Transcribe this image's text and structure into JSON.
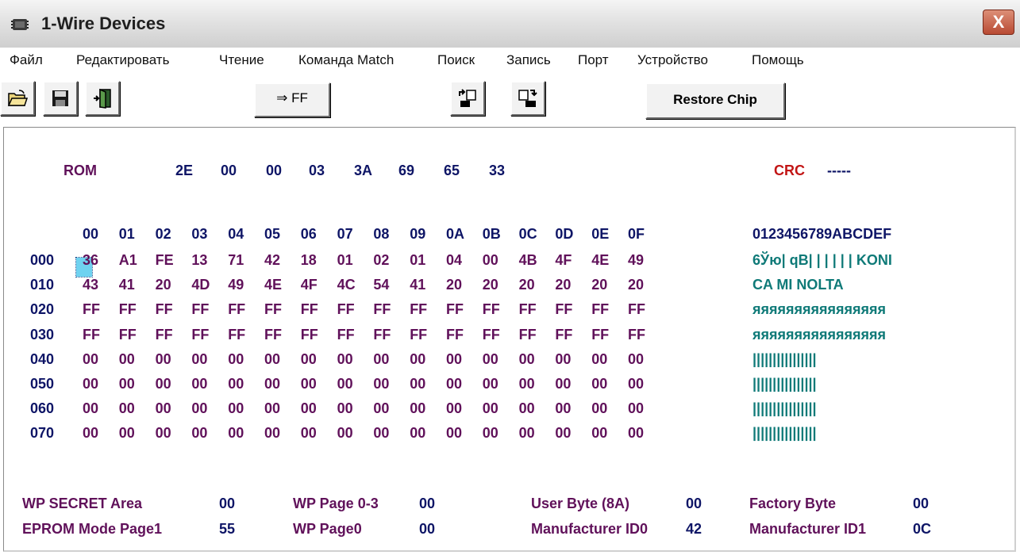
{
  "window": {
    "title": "1-Wire Devices",
    "close_glyph": "X",
    "icon": "chip-icon"
  },
  "menu": [
    "Файл",
    "Редактировать",
    "Чтение",
    "Команда Match",
    "Поиск",
    "Запись",
    "Порт",
    "Устройство",
    "Помощь"
  ],
  "toolbar": {
    "open_icon": "open-folder-icon",
    "save_icon": "save-disk-icon",
    "exit_icon": "exit-door-icon",
    "fill_label": "⇒ FF",
    "read_icon": "read-chip-icon",
    "write_icon": "write-chip-icon",
    "restore_label": "Restore Chip"
  },
  "rom": {
    "label": "ROM",
    "bytes": [
      "2E",
      "00",
      "00",
      "03",
      "3A",
      "69",
      "65",
      "33"
    ],
    "crc_label": "CRC",
    "crc_value": "-----"
  },
  "hex": {
    "col_headers": [
      "00",
      "01",
      "02",
      "03",
      "04",
      "05",
      "06",
      "07",
      "08",
      "09",
      "0A",
      "0B",
      "0C",
      "0D",
      "0E",
      "0F"
    ],
    "ascii_header": "0123456789ABCDEF",
    "rows": [
      {
        "addr": "000",
        "bytes": [
          "36",
          "A1",
          "FE",
          "13",
          "71",
          "42",
          "18",
          "01",
          "02",
          "01",
          "04",
          "00",
          "4B",
          "4F",
          "4E",
          "49"
        ],
        "ascii": "6Ўю| qB| | | | | | KONI"
      },
      {
        "addr": "010",
        "bytes": [
          "43",
          "41",
          "20",
          "4D",
          "49",
          "4E",
          "4F",
          "4C",
          "54",
          "41",
          "20",
          "20",
          "20",
          "20",
          "20",
          "20"
        ],
        "ascii": "CA MI NOLTA"
      },
      {
        "addr": "020",
        "bytes": [
          "FF",
          "FF",
          "FF",
          "FF",
          "FF",
          "FF",
          "FF",
          "FF",
          "FF",
          "FF",
          "FF",
          "FF",
          "FF",
          "FF",
          "FF",
          "FF"
        ],
        "ascii": "яяяяяяяяяяяяяяяя"
      },
      {
        "addr": "030",
        "bytes": [
          "FF",
          "FF",
          "FF",
          "FF",
          "FF",
          "FF",
          "FF",
          "FF",
          "FF",
          "FF",
          "FF",
          "FF",
          "FF",
          "FF",
          "FF",
          "FF"
        ],
        "ascii": "яяяяяяяяяяяяяяяя"
      },
      {
        "addr": "040",
        "bytes": [
          "00",
          "00",
          "00",
          "00",
          "00",
          "00",
          "00",
          "00",
          "00",
          "00",
          "00",
          "00",
          "00",
          "00",
          "00",
          "00"
        ],
        "ascii": "||||||||||||||||"
      },
      {
        "addr": "050",
        "bytes": [
          "00",
          "00",
          "00",
          "00",
          "00",
          "00",
          "00",
          "00",
          "00",
          "00",
          "00",
          "00",
          "00",
          "00",
          "00",
          "00"
        ],
        "ascii": "||||||||||||||||"
      },
      {
        "addr": "060",
        "bytes": [
          "00",
          "00",
          "00",
          "00",
          "00",
          "00",
          "00",
          "00",
          "00",
          "00",
          "00",
          "00",
          "00",
          "00",
          "00",
          "00"
        ],
        "ascii": "||||||||||||||||"
      },
      {
        "addr": "070",
        "bytes": [
          "00",
          "00",
          "00",
          "00",
          "00",
          "00",
          "00",
          "00",
          "00",
          "00",
          "00",
          "00",
          "00",
          "00",
          "00",
          "00"
        ],
        "ascii": "||||||||||||||||"
      }
    ]
  },
  "fields": {
    "wp_secret_label": "WP SECRET Area",
    "wp_secret_value": "00",
    "wp_page03_label": "WP Page 0-3",
    "wp_page03_value": "00",
    "user_byte_label": "User Byte (8A)",
    "user_byte_value": "00",
    "factory_byte_label": "Factory Byte",
    "factory_byte_value": "00",
    "eprom_label": "EPROM Mode Page1",
    "eprom_value": "55",
    "wp_page0_label": "WP Page0",
    "wp_page0_value": "00",
    "mfr_id0_label": "Manufacturer ID0",
    "mfr_id0_value": "42",
    "mfr_id1_label": "Manufacturer ID1",
    "mfr_id1_value": "0C"
  },
  "colors": {
    "hex_bytes": "#60115a",
    "headers": "#0e1566",
    "crc": "#c21515",
    "ascii": "#0f7a78",
    "cursor": "#6fd2f0"
  }
}
